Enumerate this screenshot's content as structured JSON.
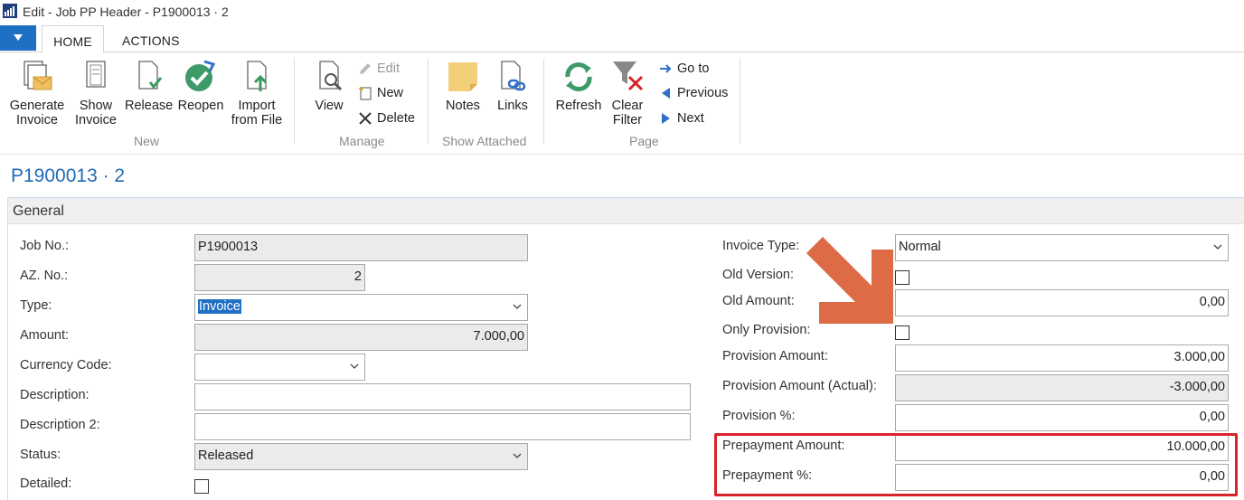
{
  "window": {
    "title": "Edit - Job PP Header - P1900013 · 2"
  },
  "ribbon_tabs": {
    "home": "HOME",
    "actions": "ACTIONS"
  },
  "ribbon": {
    "new_group": {
      "label": "New",
      "generate_invoice": "Generate\nInvoice",
      "show_invoice": "Show\nInvoice",
      "release": "Release",
      "reopen": "Reopen",
      "import_from_file": "Import\nfrom File"
    },
    "manage_group": {
      "label": "Manage",
      "view": "View",
      "edit": "Edit",
      "new": "New",
      "delete": "Delete"
    },
    "show_attached_group": {
      "label": "Show Attached",
      "notes": "Notes",
      "links": "Links"
    },
    "page_group": {
      "label": "Page",
      "refresh": "Refresh",
      "clear_filter": "Clear\nFilter",
      "go_to": "Go to",
      "previous": "Previous",
      "next": "Next"
    }
  },
  "page": {
    "title": "P1900013 · 2",
    "section": "General"
  },
  "left_fields": {
    "job_no": {
      "label": "Job No.:",
      "value": "P1900013"
    },
    "az_no": {
      "label": "AZ. No.:",
      "value": "2"
    },
    "type": {
      "label": "Type:",
      "value": "Invoice"
    },
    "amount": {
      "label": "Amount:",
      "value": "7.000,00"
    },
    "currency_code": {
      "label": "Currency Code:",
      "value": ""
    },
    "description": {
      "label": "Description:",
      "value": ""
    },
    "description2": {
      "label": "Description 2:",
      "value": ""
    },
    "status": {
      "label": "Status:",
      "value": "Released"
    },
    "detailed": {
      "label": "Detailed:",
      "checked": false
    }
  },
  "right_fields": {
    "invoice_type": {
      "label": "Invoice Type:",
      "value": "Normal"
    },
    "old_version": {
      "label": "Old Version:",
      "checked": false
    },
    "old_amount": {
      "label": "Old Amount:",
      "value": "0,00"
    },
    "only_provision": {
      "label": "Only Provision:",
      "checked": false
    },
    "provision_amount": {
      "label": "Provision Amount:",
      "value": "3.000,00"
    },
    "provision_amount_actual": {
      "label": "Provision Amount (Actual):",
      "value": "-3.000,00"
    },
    "provision_pct": {
      "label": "Provision %:",
      "value": "0,00"
    },
    "prepayment_amount": {
      "label": "Prepayment Amount:",
      "value": "10.000,00"
    },
    "prepayment_pct": {
      "label": "Prepayment %:",
      "value": "0,00"
    }
  },
  "colors": {
    "accent": "#1f6fc5",
    "highlight": "#d8232a",
    "arrow": "#dd6b45"
  }
}
